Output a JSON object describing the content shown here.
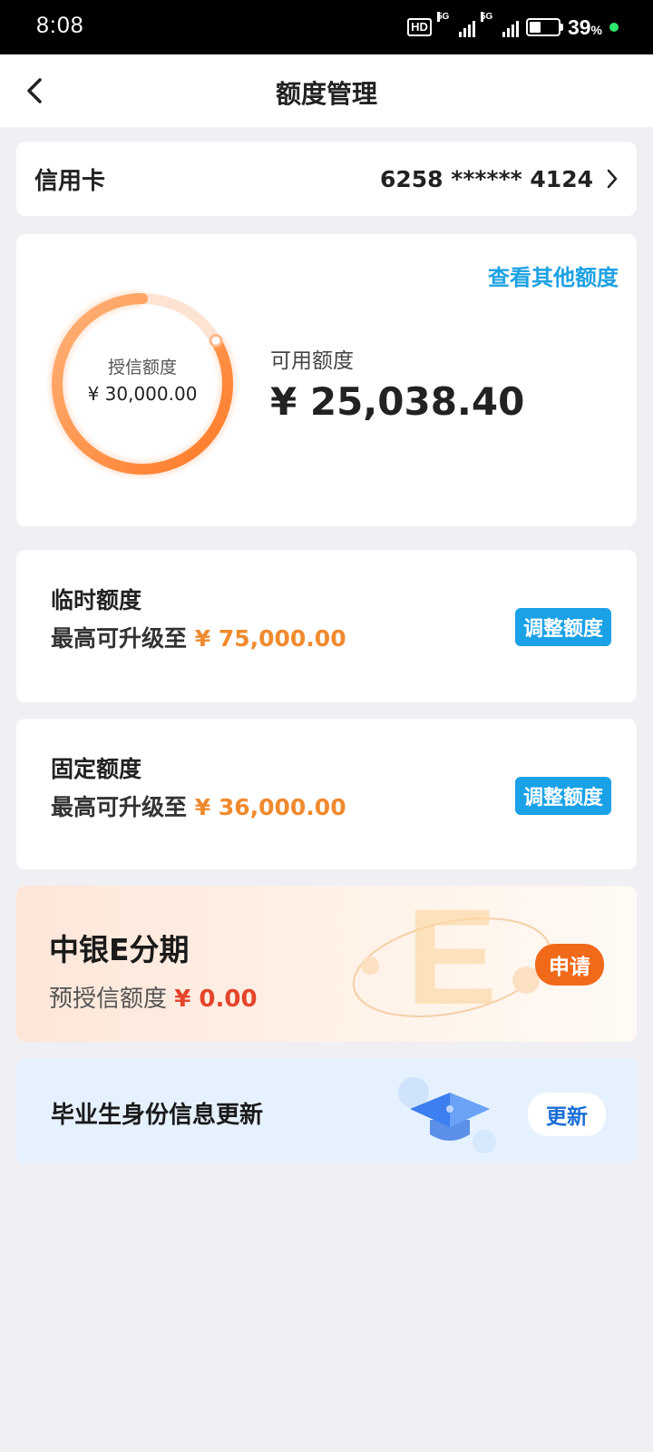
{
  "status": {
    "time": "8:08",
    "hd_badge": "HD",
    "net1": "5G",
    "net2": "5G",
    "battery_percent": "39",
    "battery_unit": "%",
    "battery_level": 0.39
  },
  "nav": {
    "title": "额度管理",
    "back_icon": "chevron-left-icon"
  },
  "card_row": {
    "label": "信用卡",
    "number": "6258 ****** 4124"
  },
  "quota": {
    "link": "查看其他额度",
    "credit_label": "授信额度",
    "credit_value": "¥ 30,000.00",
    "available_label": "可用额度",
    "available_value": "¥ 25,038.40",
    "available_fraction": 0.8346,
    "ring_color": "#ff8c3a"
  },
  "limits": [
    {
      "title": "临时额度",
      "desc": "最高可升级至",
      "amount": "¥ 75,000.00",
      "button": "调整额度"
    },
    {
      "title": "固定额度",
      "desc": "最高可升级至",
      "amount": "¥ 36,000.00",
      "button": "调整额度"
    }
  ],
  "promo": {
    "title": "中银E分期",
    "desc": "预授信额度",
    "amount": "¥ 0.00",
    "button": "申请",
    "deco_letter": "E"
  },
  "graduate": {
    "title": "毕业生身份信息更新",
    "button": "更新",
    "icon": "graduation-cap-icon"
  },
  "colors": {
    "accent_blue": "#1aa1e6",
    "amount_orange": "#f08a2e",
    "apply_orange": "#f06a1a",
    "promo_red": "#e5442b"
  }
}
